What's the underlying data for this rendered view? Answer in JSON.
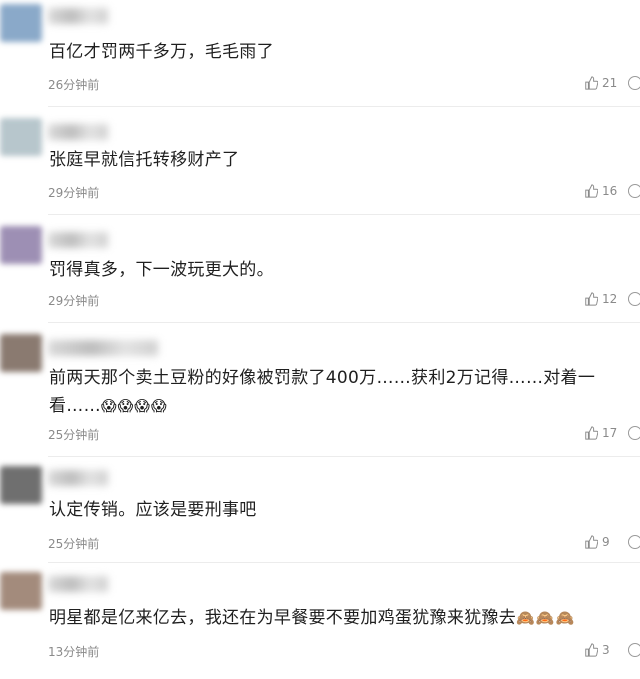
{
  "comments": [
    {
      "text": "百亿才罚两千多万，毛毛雨了",
      "emoji": "",
      "time": "26分钟前",
      "likes": "21",
      "avatar_color": "#8aa9c9"
    },
    {
      "text": "张庭早就信托转移财产了",
      "emoji": "",
      "time": "29分钟前",
      "likes": "16",
      "avatar_color": "#b7c6cc"
    },
    {
      "text": "罚得真多，下一波玩更大的。",
      "emoji": "",
      "time": "29分钟前",
      "likes": "12",
      "avatar_color": "#9d8fb4"
    },
    {
      "text": "前两天那个卖土豆粉的好像被罚款了400万……获利2万记得……对着一看……",
      "emoji": "😱😱😱😱",
      "time": "25分钟前",
      "likes": "17",
      "avatar_color": "#8a7a70"
    },
    {
      "text": "认定传销。应该是要刑事吧",
      "emoji": "",
      "time": "25分钟前",
      "likes": "9",
      "avatar_color": "#6f6f6f"
    },
    {
      "text": "明星都是亿来亿去，我还在为早餐要不要加鸡蛋犹豫来犹豫去",
      "emoji": "🙈🙈🙈",
      "time": "13分钟前",
      "likes": "3",
      "avatar_color": "#a38b7c"
    }
  ]
}
